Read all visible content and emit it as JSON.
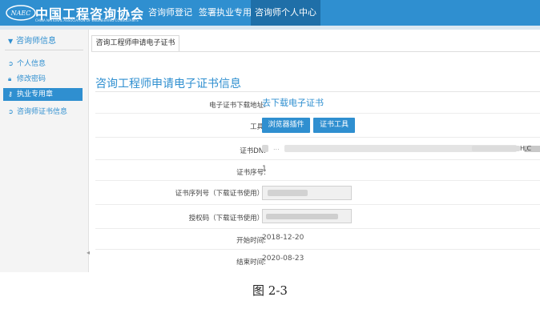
{
  "header": {
    "logo_text": "NAEC",
    "org_name": "中国工程咨询协会",
    "org_name_en": "CHINA NATIONAL ASSOCIATION OF ENGINEERING CONSULTANTS",
    "nav": [
      {
        "label": "咨询师登记",
        "active": false
      },
      {
        "label": "签署执业专用章",
        "active": false
      },
      {
        "label": "咨询师个人中心",
        "active": true
      }
    ],
    "colors": {
      "brand": "#2f8fd0",
      "nav_active": "#1f6fa8"
    }
  },
  "sidebar": {
    "section_title": "咨询师信息",
    "section_icon": "chevron-down-icon",
    "items": [
      {
        "label": "个人信息",
        "icon": "circle-arrow-icon",
        "active": false
      },
      {
        "label": "修改密码",
        "icon": "lock-icon",
        "active": false
      },
      {
        "label": "执业专用章",
        "icon": "key-icon",
        "active": true
      },
      {
        "label": "咨询师证书信息",
        "icon": "circle-arrow-icon",
        "active": false
      }
    ]
  },
  "tab": {
    "label": "咨询工程师申请电子证书"
  },
  "main": {
    "title": "咨询工程师申请电子证书信息",
    "rows": {
      "download": {
        "label": "电子证书下载地址:",
        "link": "去下载电子证书"
      },
      "tools": {
        "label": "工具:",
        "buttons": [
          "浏览器插件",
          "证书工具"
        ]
      },
      "dn": {
        "label": "证书DN:",
        "visible_fragments": [
          "...",
          "H,C"
        ]
      },
      "seq": {
        "label": "证书序号:",
        "value": "1"
      },
      "serial": {
        "label": "证书序列号（下载证书使用）:"
      },
      "auth": {
        "label": "授权码（下载证书使用）:"
      },
      "start": {
        "label": "开始时间:",
        "value": "2018-12-20"
      },
      "end": {
        "label": "结束时间:",
        "value": "2020-08-23"
      }
    }
  },
  "caption": "图 2-3"
}
